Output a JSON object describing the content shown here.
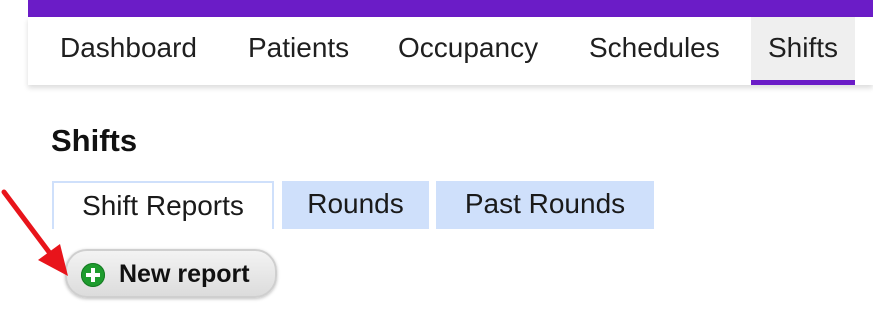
{
  "colors": {
    "brand": "#6b1cc7",
    "tab_blue": "#cfe0fb",
    "add_green": "#1e9c2e",
    "arrow_red": "#e8141b"
  },
  "nav": {
    "items": [
      {
        "label": "Dashboard"
      },
      {
        "label": "Patients"
      },
      {
        "label": "Occupancy"
      },
      {
        "label": "Schedules"
      },
      {
        "label": "Shifts"
      }
    ],
    "active": "Shifts"
  },
  "main": {
    "title": "Shifts",
    "tabs": [
      {
        "label": "Shift Reports"
      },
      {
        "label": "Rounds"
      },
      {
        "label": "Past Rounds"
      }
    ],
    "active_tab": "Shift Reports",
    "new_report_button": {
      "label": "New report",
      "icon": "plus-circle-icon"
    }
  },
  "annotation": {
    "icon": "red-arrow-icon"
  }
}
